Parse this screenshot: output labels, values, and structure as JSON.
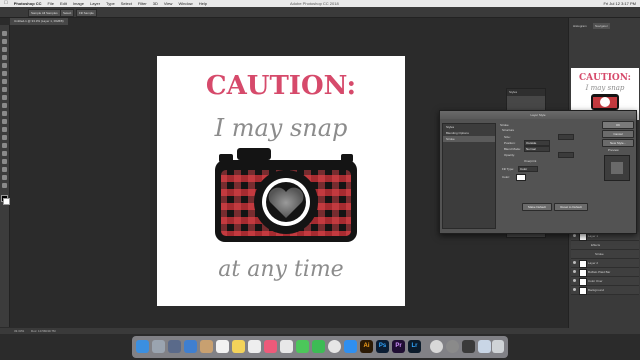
{
  "menubar": {
    "apple_icon": "apple-icon",
    "items": [
      "Photoshop CC",
      "File",
      "Edit",
      "Image",
      "Layer",
      "Type",
      "Select",
      "Filter",
      "3D",
      "View",
      "Window",
      "Help"
    ],
    "window_title": "Adobe Photoshop CC 2018",
    "clock": "Fri Jul 12  3:17 PM"
  },
  "options_bar": {
    "buttons": [
      "Sample All Samples",
      "Select",
      "Fill Sample"
    ]
  },
  "document": {
    "tab_label": "Untitled-1 @ 33.3% (Layer 1, RGB/8)"
  },
  "artwork": {
    "line1": "CAUTION:",
    "line2": "I may snap",
    "line3": "at any time",
    "colors": {
      "pink": "#d64a6b",
      "gray": "#8c8c8c",
      "red": "#c33a3f",
      "black": "#141414"
    }
  },
  "right_dock": {
    "tabs": [
      "Histogram",
      "Navigator"
    ],
    "layers": [
      {
        "name": "Layer 1"
      },
      {
        "name": "Effects"
      },
      {
        "name": "Stroke"
      },
      {
        "name": "Layer 2"
      },
      {
        "name": "Buffalo Plaid Bar"
      },
      {
        "name": "Color Over"
      },
      {
        "name": "Background"
      }
    ]
  },
  "small_panel": {
    "title": "Styles"
  },
  "layer_style": {
    "title": "Layer Style",
    "styles": [
      "Styles",
      "Blending Options",
      "Stroke"
    ],
    "selected_style": "Stroke",
    "section": "Stroke",
    "group": "Structure",
    "labels": {
      "size": "Size:",
      "position": "Position:",
      "blend_mode": "Blend Mode:",
      "opacity": "Opacity:",
      "overprint": "Overprint",
      "fill_type": "Fill Type:",
      "color": "Color:"
    },
    "values": {
      "position": "Outside",
      "blend_mode": "Normal",
      "fill_type": "Color"
    },
    "buttons": {
      "ok": "OK",
      "cancel": "Cancel",
      "new_style": "New Style...",
      "preview": "Preview",
      "make_default": "Make Default",
      "reset_default": "Reset to Default"
    }
  },
  "status": {
    "zoom": "33.33%",
    "doc": "Doc: 10.5M/40.7M"
  },
  "dock": {
    "icons": [
      "finder",
      "launchpad",
      "safari",
      "mail",
      "contacts",
      "calendar",
      "notes",
      "reminders",
      "music",
      "photos",
      "messages",
      "facetime",
      "chrome",
      "appstore",
      "illustrator",
      "photoshop",
      "premiere",
      "lightroom",
      "preview",
      "sysprefs",
      "quicktime",
      "finder2",
      "trash"
    ],
    "labels": {
      "illustrator": "Ai",
      "photoshop": "Ps",
      "premiere": "Pr",
      "lightroom": "Lr"
    }
  }
}
